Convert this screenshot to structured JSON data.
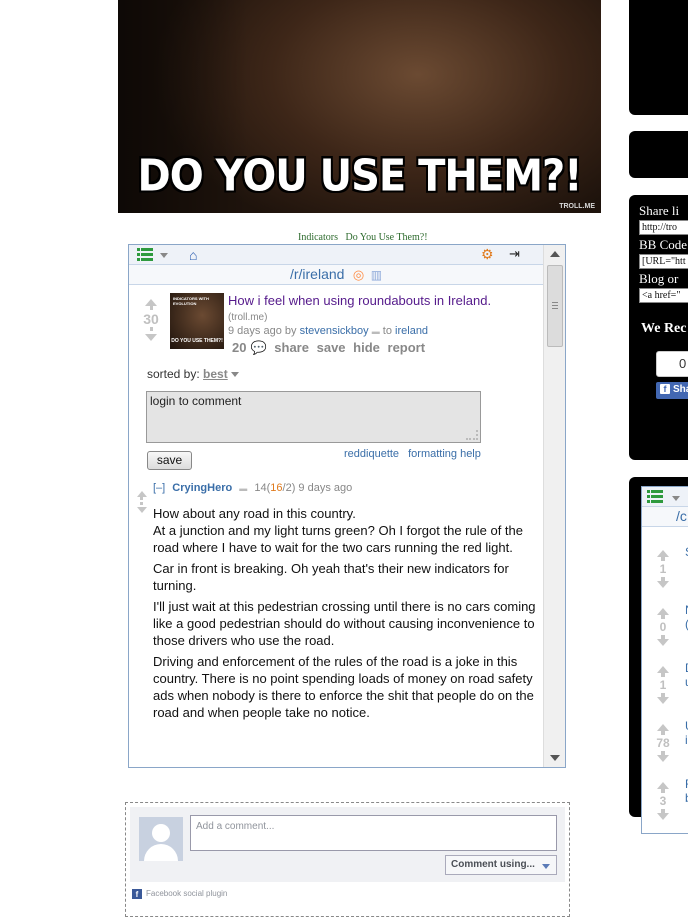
{
  "meme": {
    "caption": "DO YOU USE THEM?!",
    "watermark": "TROLL.ME"
  },
  "tags": [
    "Indicators",
    "Do You Use Them?!"
  ],
  "widget": {
    "subreddit": "/r/ireland",
    "post": {
      "score": "30",
      "title": "How i feel when using roundabouts in Ireland.",
      "domain": "(troll.me)",
      "age": "9 days ago by",
      "author": "stevensickboy",
      "to_label": "to",
      "target": "ireland",
      "comment_count": "20",
      "actions": [
        "share",
        "save",
        "hide",
        "report"
      ],
      "thumb_top": "INDICATORS WITH EVOLUTION",
      "thumb_caption": "DO YOU USE THEM?!"
    },
    "sorted_label": "sorted by:",
    "sorted_value": "best",
    "textarea_text": "login to comment",
    "save_label": "save",
    "help_links": [
      "reddiquette",
      "formatting help"
    ],
    "comment": {
      "toggle": "[–]",
      "author": "CryingHero",
      "points_total": "14",
      "points_up": "16",
      "points_down": "2",
      "age": "9 days ago",
      "paragraphs": [
        "How about any road in this country.\nAt a junction and my light turns green? Oh I forgot the rule of the road where I have to wait for the two cars running the red light.",
        "Car in front is breaking. Oh yeah that's their new indicators for turning.",
        "I'll just wait at this pedestrian crossing until there is no cars coming like a good pedestrian should do without causing inconvenience to those drivers who use the road.",
        "Driving and enforcement of the rules of the road is a joke in this country. There is no point spending loads of money on road safety ads when nobody is there to enforce the shit that people do on the road and when people take no notice."
      ]
    }
  },
  "facebook": {
    "placeholder": "Add a comment...",
    "button": "Comment using...",
    "plugin_label": "Facebook social plugin"
  },
  "sidebar": {
    "share_link_label": "Share li",
    "share_link_value": "http://tro",
    "bb_code_label": "BB Code",
    "bb_code_value": "[URL=\"htt",
    "blog_label": "Blog or",
    "blog_value": "<a href=\"",
    "we_rec": "We Rec",
    "like_count": "0",
    "fb_share": "Sha",
    "mini_sub": "/c",
    "mini_items": [
      {
        "score": "1",
        "title": "S"
      },
      {
        "score": "0",
        "title": "N\n("
      },
      {
        "score": "1",
        "title": "D\nu"
      },
      {
        "score": "78",
        "title": "U\ni"
      },
      {
        "score": "3",
        "title": "F\nb"
      }
    ]
  },
  "colors": {
    "link": "#3a6ea8",
    "visited": "#551a8b",
    "accent_orange": "#e07a1c",
    "tag_green": "#2e6b2e",
    "fb_blue": "#4267b2"
  },
  "icons": [
    "list-icon",
    "home-icon",
    "gear-icon",
    "login-icon",
    "rss-icon",
    "stats-icon",
    "comment-bubble-icon",
    "facebook-icon"
  ]
}
